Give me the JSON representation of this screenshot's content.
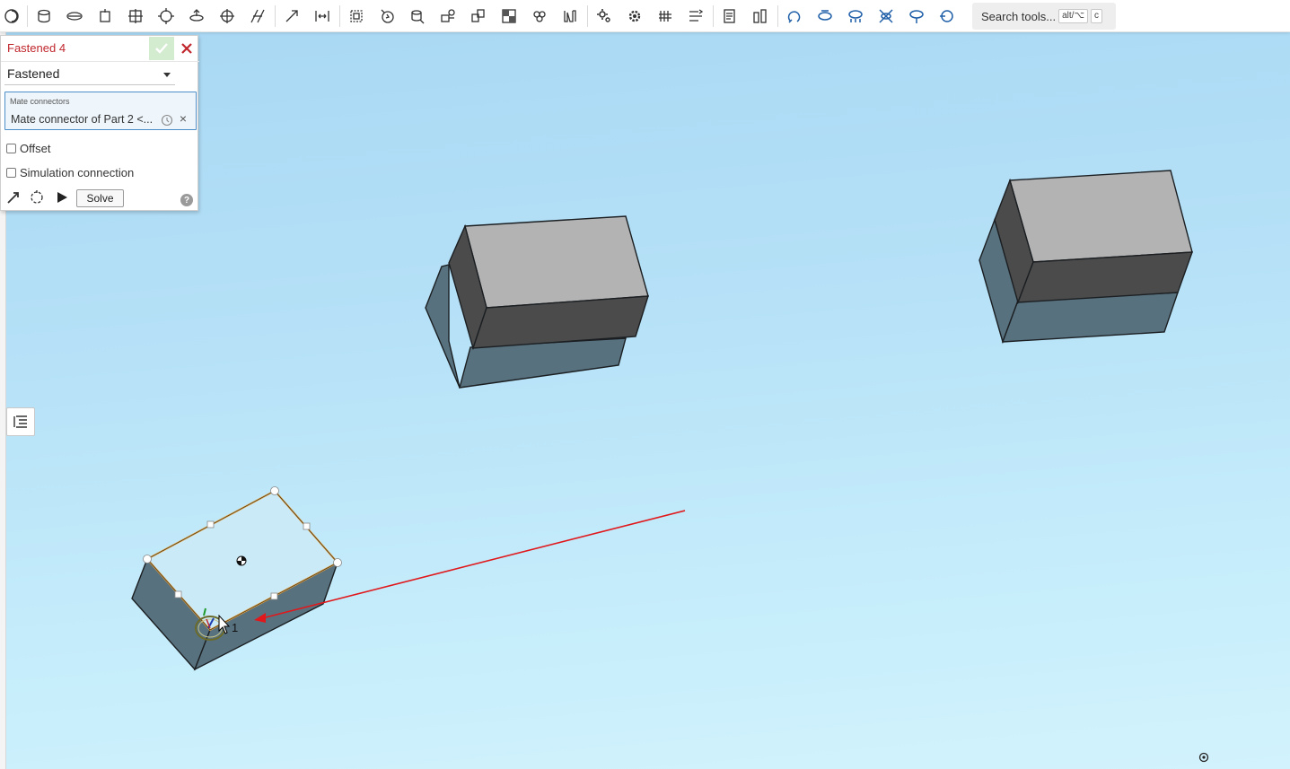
{
  "toolbar": {
    "tools": [
      {
        "name": "fastened-mate-icon"
      },
      {
        "name": "revolute-mate-icon"
      },
      {
        "name": "slider-mate-icon"
      },
      {
        "name": "cylindrical-mate-icon"
      },
      {
        "name": "planar-mate-icon"
      },
      {
        "name": "ball-mate-icon"
      },
      {
        "name": "pin-slot-mate-icon"
      },
      {
        "name": "parallel-mate-icon"
      },
      {
        "name": "tangent-mate-icon"
      },
      {
        "name": "width-mate-icon"
      },
      {
        "name": "group-icon"
      },
      {
        "name": "mate-connector-icon"
      },
      {
        "name": "insert-icon"
      },
      {
        "name": "replicate-icon"
      },
      {
        "name": "linear-pattern-icon"
      },
      {
        "name": "section-view-icon"
      },
      {
        "name": "explode-icon"
      },
      {
        "name": "display-states-icon"
      },
      {
        "name": "gear-relation-icon"
      },
      {
        "name": "rack-pinion-icon"
      },
      {
        "name": "screw-relation-icon"
      },
      {
        "name": "linear-relation-icon"
      },
      {
        "name": "measure-icon"
      },
      {
        "name": "mass-properties-icon"
      },
      {
        "name": "flip-icon"
      },
      {
        "name": "rotate-icon"
      },
      {
        "name": "rotate-axis-icon"
      },
      {
        "name": "transform-icon"
      },
      {
        "name": "orient-icon"
      },
      {
        "name": "spin-icon"
      }
    ],
    "search": {
      "placeholder": "Search tools...",
      "key1": "alt/⌥",
      "key2": "c"
    }
  },
  "dialog": {
    "title": "Fastened 4",
    "mate_type": "Fastened",
    "mate_connectors_label": "Mate connectors",
    "mate_connector_item": "Mate connector of Part 2 <...",
    "offset_label": "Offset",
    "simulation_label": "Simulation connection",
    "solve_label": "Solve",
    "help_label": "?"
  },
  "viewport": {
    "connector_label": "1",
    "colors": {
      "face_top": "#b3b3b3",
      "face_dark": "#4b4b4b",
      "face_blue": "#58717f",
      "selected_face": "#cbeaf7",
      "selection_outline": "#e6a23c",
      "arrow": "#e0181b"
    }
  }
}
